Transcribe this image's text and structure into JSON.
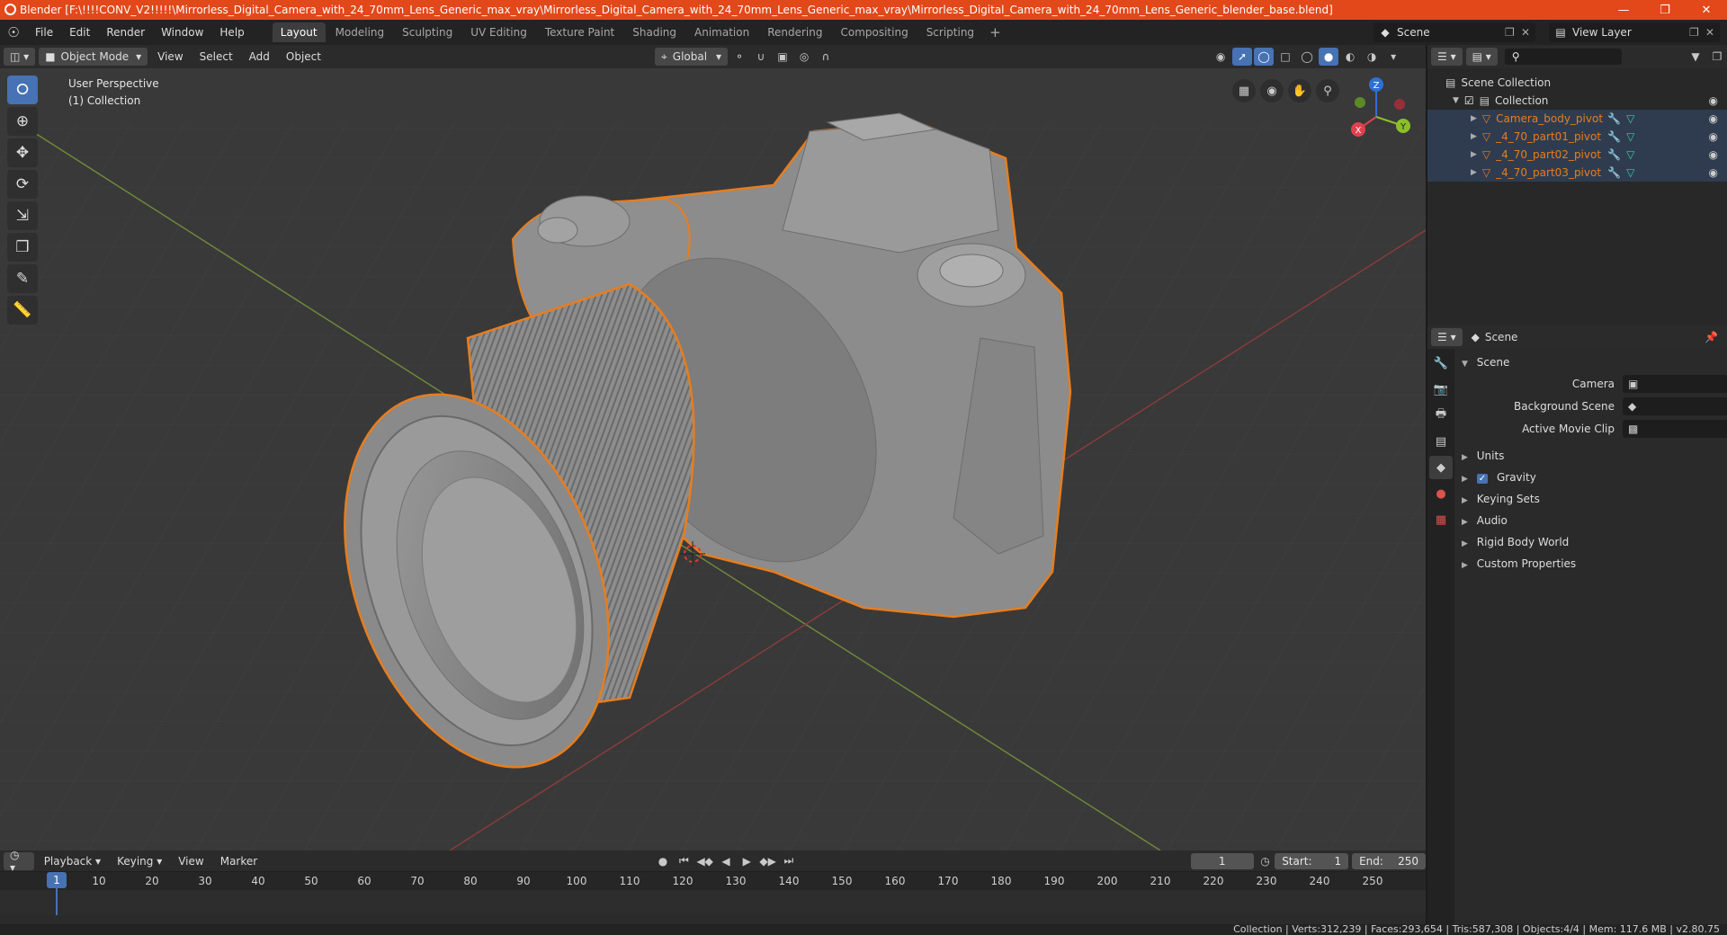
{
  "title": "Blender [F:\\!!!!CONV_V2!!!!!\\Mirrorless_Digital_Camera_with_24_70mm_Lens_Generic_max_vray\\Mirrorless_Digital_Camera_with_24_70mm_Lens_Generic_max_vray\\Mirrorless_Digital_Camera_with_24_70mm_Lens_Generic_blender_base.blend]",
  "menu": [
    "File",
    "Edit",
    "Render",
    "Window",
    "Help"
  ],
  "workspace_tabs": [
    "Layout",
    "Modeling",
    "Sculpting",
    "UV Editing",
    "Texture Paint",
    "Shading",
    "Animation",
    "Rendering",
    "Compositing",
    "Scripting"
  ],
  "scene_name": "Scene",
  "view_layer": "View Layer",
  "viewport_header": {
    "mode": "Object Mode",
    "menus": [
      "View",
      "Select",
      "Add",
      "Object"
    ],
    "orientation": "Global"
  },
  "viewport": {
    "info_line1": "User Perspective",
    "info_line2": "(1) Collection",
    "gizmo": {
      "x": "X",
      "y": "Y",
      "z": "Z"
    }
  },
  "timeline": {
    "menus": [
      "Playback",
      "Keying",
      "View",
      "Marker"
    ],
    "current_frame": "1",
    "start_label": "Start:",
    "start": "1",
    "end_label": "End:",
    "end": "250",
    "playhead": "1",
    "ruler": [
      "10",
      "20",
      "30",
      "40",
      "50",
      "60",
      "70",
      "80",
      "90",
      "100",
      "110",
      "120",
      "130",
      "140",
      "150",
      "160",
      "170",
      "180",
      "190",
      "200",
      "210",
      "220",
      "230",
      "240",
      "250"
    ]
  },
  "outliner": {
    "scene_collection": "Scene Collection",
    "collection": "Collection",
    "objects": [
      "Camera_body_pivot",
      "_4_70_part01_pivot",
      "_4_70_part02_pivot",
      "_4_70_part03_pivot"
    ]
  },
  "properties": {
    "header": "Scene",
    "panel": "Scene",
    "camera_label": "Camera",
    "background_scene_label": "Background Scene",
    "active_movie_clip_label": "Active Movie Clip",
    "sections": [
      "Units",
      "Gravity",
      "Keying Sets",
      "Audio",
      "Rigid Body World",
      "Custom Properties"
    ]
  },
  "status": "Collection | Verts:312,239 | Faces:293,654 | Tris:587,308 | Objects:4/4 | Mem: 117.6 MB | v2.80.75",
  "colors": {
    "accent": "#4772b3",
    "selection": "#e87d1d",
    "titlebar": "#e2481a"
  }
}
